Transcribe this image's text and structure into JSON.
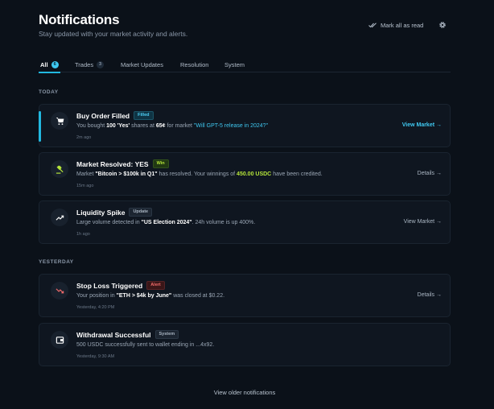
{
  "header": {
    "title": "Notifications",
    "subtitle": "Stay updated with your market activity and alerts.",
    "mark_all": "Mark all as read"
  },
  "tabs": [
    {
      "label": "All",
      "count": "6",
      "active": true
    },
    {
      "label": "Trades",
      "count": "3"
    },
    {
      "label": "Market Updates"
    },
    {
      "label": "Resolution"
    },
    {
      "label": "System"
    }
  ],
  "sections": {
    "today": "TODAY",
    "yesterday": "YESTERDAY"
  },
  "notifications": [
    {
      "title": "Buy Order Filled",
      "badge": "Filled",
      "body_pre": "You bought ",
      "body_b1": "100 'Yes'",
      "body_mid": " shares at ",
      "body_b2": "65¢",
      "body_mid2": " for market ",
      "body_link": "\"Will GPT-5 release in 2024?\"",
      "time": "2m ago",
      "action": "View Market →",
      "icon": "cart-icon"
    },
    {
      "title": "Market Resolved: YES",
      "badge": "Win",
      "body_pre": "Market ",
      "body_b1": "\"Bitcoin > $100k in Q1\"",
      "body_mid": " has resolved. Your winnings of ",
      "body_green": "450.00 USDC",
      "body_end": " have been credited.",
      "time": "15m ago",
      "action": "Details →",
      "icon": "gavel-icon"
    },
    {
      "title": "Liquidity Spike",
      "badge": "Update",
      "body_pre": "Large volume detected in ",
      "body_b1": "\"US Election 2024\"",
      "body_end": ". 24h volume is up 400%.",
      "time": "1h ago",
      "action": "View Market →",
      "icon": "trending-up-icon"
    },
    {
      "title": "Stop Loss Triggered",
      "badge": "Alert",
      "body_pre": "Your position in ",
      "body_b1": "\"ETH > $4k by June\"",
      "body_end": " was closed at $0.22.",
      "time": "Yesterday, 4:20 PM",
      "action": "Details →",
      "icon": "trending-down-icon"
    },
    {
      "title": "Withdrawal Successful",
      "badge": "System",
      "body_pre": "500 USDC successfully sent to wallet ending in ...4x92.",
      "time": "Yesterday, 9:30 AM",
      "icon": "wallet-icon"
    }
  ],
  "footer": {
    "older": "View older notifications"
  },
  "colors": {
    "accent": "#22b8df",
    "win": "#b6e63a",
    "alert": "#f06b6b",
    "background": "#0b1119"
  }
}
